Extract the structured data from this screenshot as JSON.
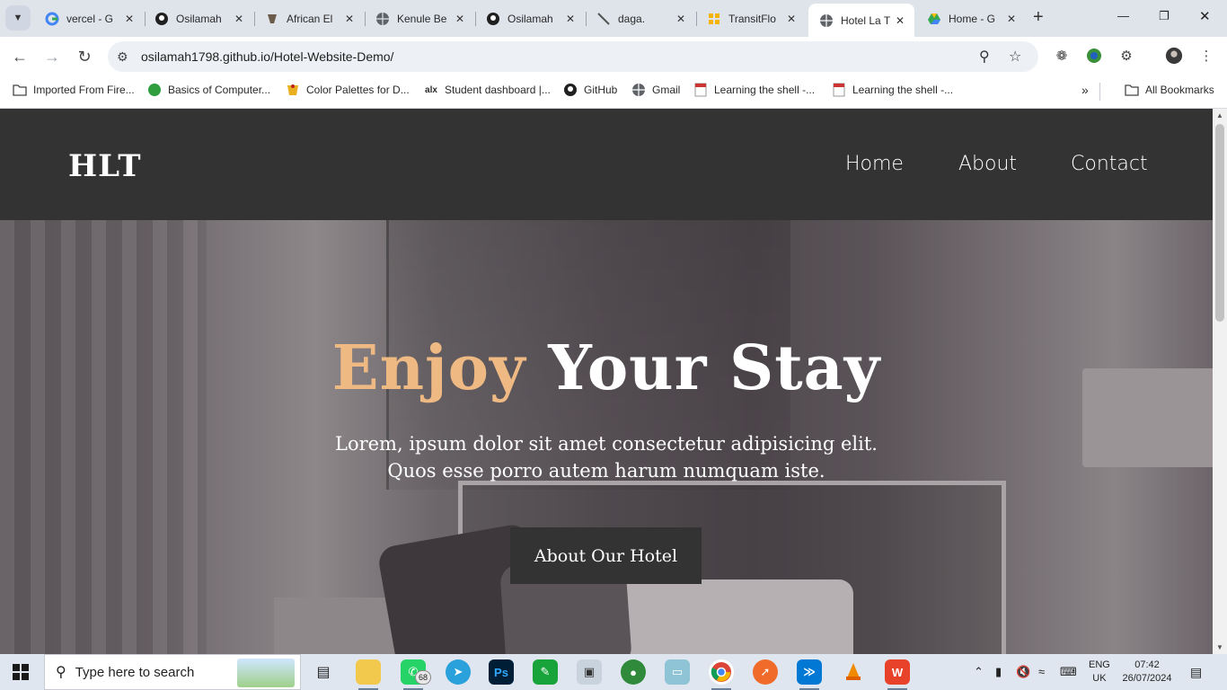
{
  "browser": {
    "tabs": [
      {
        "title": "vercel - G",
        "icon": "google-icon",
        "active": false
      },
      {
        "title": "Osilamah",
        "icon": "github-icon",
        "active": false
      },
      {
        "title": "African El",
        "icon": "elephant-icon",
        "active": false
      },
      {
        "title": "Kenule Be",
        "icon": "globe-icon",
        "active": false
      },
      {
        "title": "Osilamah",
        "icon": "github-icon",
        "active": false
      },
      {
        "title": "daga.",
        "icon": "wand-icon",
        "active": false
      },
      {
        "title": "TransitFlo",
        "icon": "grid-icon",
        "active": false
      },
      {
        "title": "Hotel La T",
        "icon": "globe-icon",
        "active": true
      },
      {
        "title": "Home - G",
        "icon": "drive-icon",
        "active": false
      }
    ],
    "url": "osilamah1798.github.io/Hotel-Website-Demo/",
    "bookmarks": [
      {
        "label": "Imported From Fire...",
        "icon": "folder-icon"
      },
      {
        "label": "Basics of Computer...",
        "icon": "leaf-icon"
      },
      {
        "label": "Color Palettes for D...",
        "icon": "palette-icon"
      },
      {
        "label": "Student dashboard |...",
        "icon": "alx-icon"
      },
      {
        "label": "GitHub",
        "icon": "github-icon"
      },
      {
        "label": "Gmail",
        "icon": "globe-icon"
      },
      {
        "label": "Learning the shell -...",
        "icon": "page-icon"
      },
      {
        "label": "Learning the shell -...",
        "icon": "page-icon"
      }
    ],
    "all_bookmarks": "All Bookmarks"
  },
  "site": {
    "logo": "HLT",
    "nav": [
      "Home",
      "About",
      "Contact"
    ],
    "hero": {
      "title_accent": "Enjoy",
      "title_rest": " Your Stay",
      "subtitle_line1": "Lorem, ipsum dolor sit amet consectetur adipisicing elit.",
      "subtitle_line2": "Quos esse porro autem harum numquam iste.",
      "button": "About Our Hotel"
    },
    "colors": {
      "header": "#333333",
      "accent": "#efb983",
      "hero_overlay": "#5e565b"
    }
  },
  "taskbar": {
    "search_placeholder": "Type here to search",
    "whatsapp_badge": "68",
    "lang_line1": "ENG",
    "lang_line2": "UK",
    "time": "07:42",
    "date": "26/07/2024"
  }
}
